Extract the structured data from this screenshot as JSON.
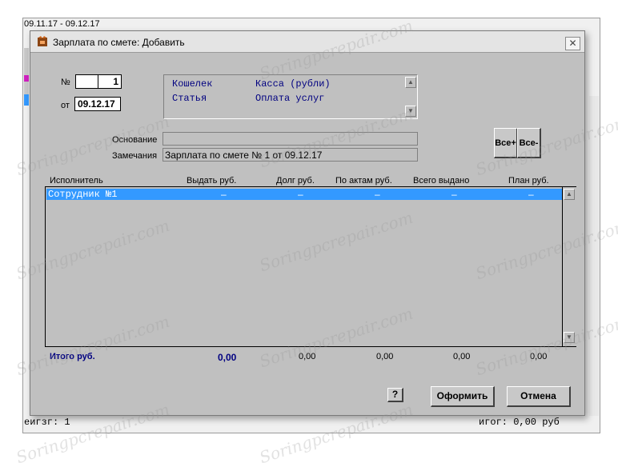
{
  "background": {
    "title": "09.11.17 - 09.12.17",
    "bottom_left": "еигзг: 1",
    "bottom_right": "игог: 0,00 руб"
  },
  "dialog": {
    "title": "Зарплата по смете: Добавить",
    "close": "✕",
    "num_label": "№",
    "num_value": "1",
    "date_label": "от",
    "date_value": "09.12.17",
    "wallet_label": "Кошелек",
    "wallet_value": "Касса (рубли)",
    "article_label": "Статья",
    "article_value": "Оплата услуг",
    "basis_label": "Основание",
    "basis_value": "",
    "remarks_label": "Замечания",
    "remarks_value": "Зарплата по смете № 1 от 09.12.17",
    "all_plus": "Все+",
    "all_minus": "Все-"
  },
  "table": {
    "columns": [
      "Исполнитель",
      "Выдать руб.",
      "Долг руб.",
      "По актам руб.",
      "Всего выдано",
      "План руб."
    ],
    "rows": [
      {
        "name": "Сотрудник №1",
        "give": "–",
        "debt": "–",
        "acts": "–",
        "total": "–",
        "plan": "–"
      }
    ]
  },
  "totals": {
    "label": "Итого руб.",
    "give": "0,00",
    "debt": "0,00",
    "acts": "0,00",
    "total": "0,00",
    "plan": "0,00"
  },
  "buttons": {
    "help": "?",
    "submit": "Оформить",
    "cancel": "Отмена"
  },
  "watermark": "Soringpcrepair.com"
}
